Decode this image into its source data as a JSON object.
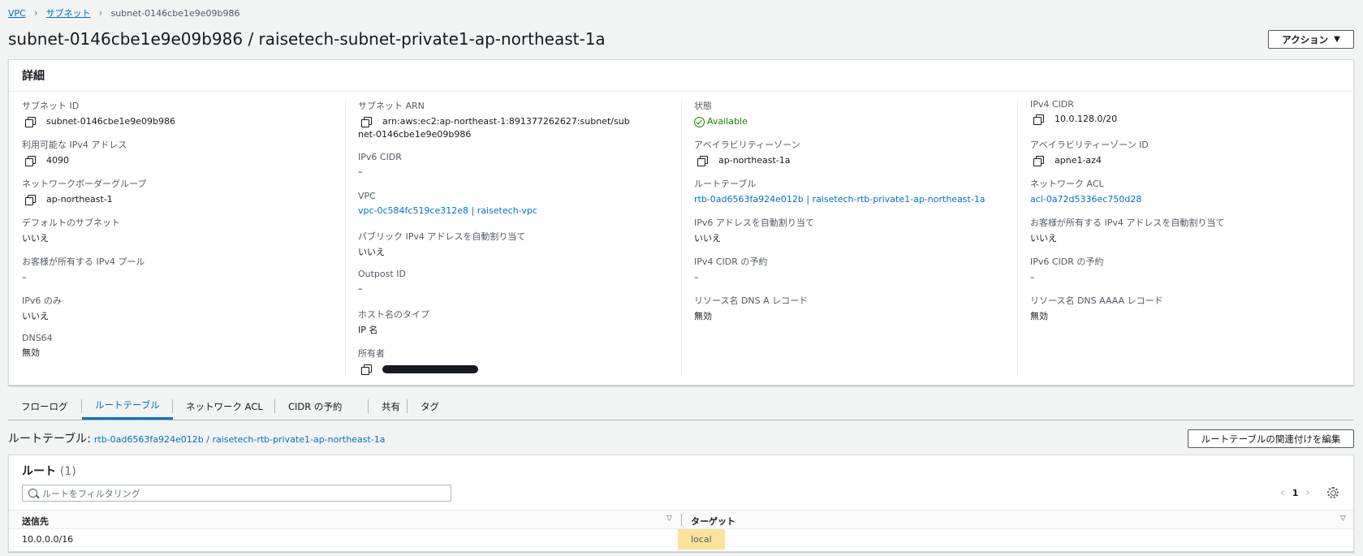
{
  "breadcrumb": {
    "vpc": "VPC",
    "subnets": "サブネット",
    "current": "subnet-0146cbe1e9e09b986"
  },
  "page": {
    "title": "subnet-0146cbe1e9e09b986 / raisetech-subnet-private1-ap-northeast-1a",
    "actions_label": "アクション"
  },
  "details": {
    "header": "詳細",
    "col1": {
      "subnet_id_label": "サブネット ID",
      "subnet_id": "subnet-0146cbe1e9e09b986",
      "available_ipv4_label": "利用可能な IPv4 アドレス",
      "available_ipv4": "4090",
      "border_group_label": "ネットワークボーダーグループ",
      "border_group": "ap-northeast-1",
      "default_subnet_label": "デフォルトのサブネット",
      "default_subnet": "いいえ",
      "customer_ipv4_pool_label": "お客様が所有する IPv4 プール",
      "customer_ipv4_pool": "–",
      "ipv6_only_label": "IPv6 のみ",
      "ipv6_only": "いいえ",
      "dns64_label": "DNS64",
      "dns64": "無効"
    },
    "col2": {
      "subnet_arn_label": "サブネット ARN",
      "subnet_arn": "arn:aws:ec2:ap-northeast-1:891377262627:subnet/subnet-0146cbe1e9e09b986",
      "ipv6_cidr_label": "IPv6 CIDR",
      "ipv6_cidr": "–",
      "vpc_label": "VPC",
      "vpc": "vpc-0c584fc519ce312e8 | raisetech-vpc",
      "public_ipv4_label": "パブリック IPv4 アドレスを自動割り当て",
      "public_ipv4": "いいえ",
      "outpost_label": "Outpost ID",
      "outpost": "–",
      "hostname_type_label": "ホスト名のタイプ",
      "hostname_type": "IP 名",
      "owner_label": "所有者"
    },
    "col3": {
      "state_label": "状態",
      "state": "Available",
      "az_label": "アベイラビリティーゾーン",
      "az": "ap-northeast-1a",
      "route_table_label": "ルートテーブル",
      "route_table": "rtb-0ad6563fa924e012b | raisetech-rtb-private1-ap-northeast-1a",
      "ipv6_auto_label": "IPv6 アドレスを自動割り当て",
      "ipv6_auto": "いいえ",
      "ipv4_cidr_reservation_label": "IPv4 CIDR の予約",
      "ipv4_cidr_reservation": "–",
      "dns_a_label": "リソース名 DNS A レコード",
      "dns_a": "無効"
    },
    "col4": {
      "ipv4_cidr_label": "IPv4 CIDR",
      "ipv4_cidr": "10.0.128.0/20",
      "az_id_label": "アベイラビリティーゾーン ID",
      "az_id": "apne1-az4",
      "network_acl_label": "ネットワーク ACL",
      "network_acl": "acl-0a72d5336ec750d28",
      "customer_ipv4_auto_label": "お客様が所有する IPv4 アドレスを自動割り当て",
      "customer_ipv4_auto": "いいえ",
      "ipv6_cidr_reservation_label": "IPv6 CIDR の予約",
      "ipv6_cidr_reservation": "–",
      "dns_aaaa_label": "リソース名 DNS AAAA レコード",
      "dns_aaaa": "無効"
    }
  },
  "tabs": [
    "フローログ",
    "ルートテーブル",
    "ネットワーク ACL",
    "CIDR の予約",
    "共有",
    "タグ"
  ],
  "route_table_section": {
    "title_prefix": "ルートテーブル:",
    "title_link": "rtb-0ad6563fa924e012b / raisetech-rtb-private1-ap-northeast-1a",
    "edit_button": "ルートテーブルの関連付けを編集"
  },
  "routes": {
    "title": "ルート",
    "count": "(1)",
    "search_placeholder": "ルートをフィルタリング",
    "page": "1",
    "columns": {
      "destination": "送信先",
      "target": "ターゲット"
    },
    "rows": [
      {
        "destination": "10.0.0.0/16",
        "target": "local"
      }
    ]
  },
  "colors": {
    "link": "#0073bb",
    "status_ok": "#1d8102",
    "highlight": "#fbe39b"
  }
}
